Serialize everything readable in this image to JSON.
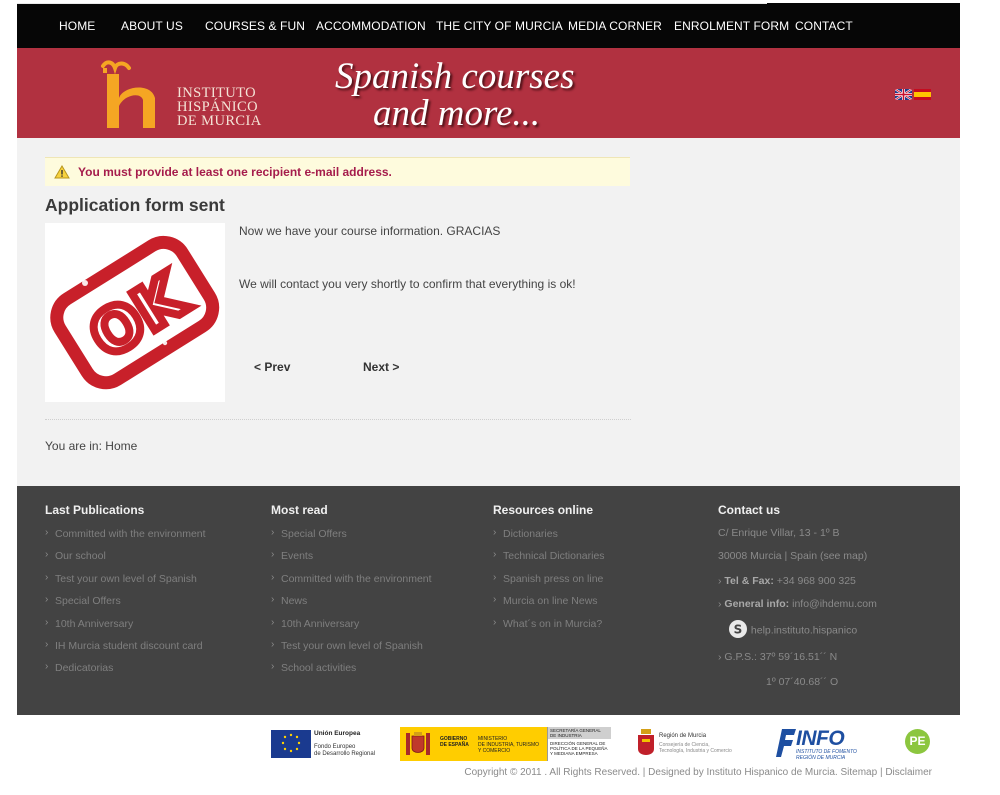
{
  "nav": {
    "items": [
      "HOME",
      "ABOUT US",
      "COURSES & FUN",
      "ACCOMMODATION",
      "THE CITY OF MURCIA",
      "MEDIA CORNER",
      "ENROLMENT FORM",
      "CONTACT"
    ]
  },
  "banner": {
    "logo_lines": [
      "INSTITUTO",
      "HISPÁNICO",
      "DE MURCIA"
    ],
    "slogan_line1": "Spanish courses",
    "slogan_line2": "and more...",
    "brand_color": "#b13140",
    "logo_color": "#f5a623"
  },
  "main": {
    "warning": "You must provide at least one recipient e-mail address.",
    "title": "Application form sent",
    "stamp_text": "OK",
    "paragraph1": "Now we have your course information. GRACIAS",
    "paragraph2": "We will contact you very shortly to confirm that everything is ok!",
    "prev_label": "< Prev",
    "next_label": "Next >",
    "breadcrumb_prefix": "You are in:",
    "breadcrumb_current": "Home"
  },
  "footer": {
    "columns": [
      {
        "title": "Last Publications",
        "items": [
          "Committed with the environment",
          "Our school",
          "Test your own level of Spanish",
          "Special Offers",
          "10th Anniversary",
          "IH Murcia student discount card",
          "Dedicatorias"
        ]
      },
      {
        "title": "Most read",
        "items": [
          "Special Offers",
          "Events",
          "Committed with the environment",
          "News",
          "10th Anniversary",
          "Test your own level of Spanish",
          "School activities"
        ]
      },
      {
        "title": "Resources online",
        "items": [
          "Dictionaries",
          "Technical Dictionaries",
          "Spanish press on line",
          "Murcia on line News",
          "What´s on in Murcia?"
        ]
      }
    ],
    "contact": {
      "title": "Contact us",
      "address1": "C/ Enrique Villar, 13 - 1º B",
      "address2": "30008 Murcia | Spain (see map)",
      "tel_label": "Tel & Fax:",
      "tel_value": "+34 968 900 325",
      "info_label": "General info:",
      "info_value": "info@ihdemu.com",
      "skype": "help.instituto.hispanico",
      "gps1": "G.P.S.: 37º 59´16.51´´ N",
      "gps2": "1º 07´40.68´´ O"
    },
    "sponsors": {
      "eu_title": "Unión Europea",
      "eu_sub1": "Fondo Europeo",
      "eu_sub2": "de Desarrollo Regional",
      "gob1": "GOBIERNO",
      "gob2": "DE ESPAÑA",
      "min1": "MINISTERIO",
      "min2": "DE INDUSTRIA, TURISMO",
      "min3": "Y COMERCIO",
      "sec1": "SECRETARÍA GENERAL",
      "sec2": "DE INDUSTRIA",
      "sec3": "DIRECCIÓN GENERAL DE",
      "sec4": "POLÍTICA DE LA PEQUEÑA",
      "sec5": "Y MEDIANA EMPRESA",
      "region_title": "Región de Murcia",
      "region_sub1": "Consejería de Ciencia,",
      "region_sub2": "Tecnología, Industria y Comercio",
      "info_logo": "INFO",
      "info_sub1": "INSTITUTO DE FOMENTO",
      "info_sub2": "REGIÓN DE MURCIA",
      "pe_logo": "PE"
    },
    "copyright": "Copyright © 2011 . All Rights Reserved. |",
    "designed": "Designed by Instituto Hispanico de Murcia.",
    "sitemap": "Sitemap",
    "disclaimer": "Disclaimer"
  }
}
